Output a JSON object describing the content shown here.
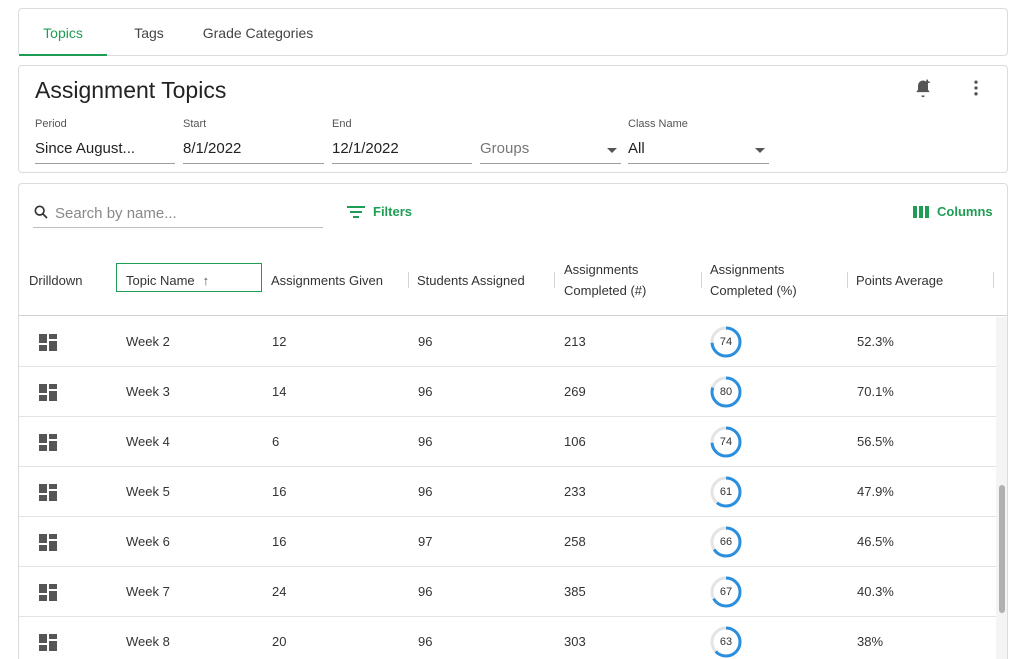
{
  "tabs": [
    {
      "label": "Topics",
      "active": true
    },
    {
      "label": "Tags",
      "active": false
    },
    {
      "label": "Grade Categories",
      "active": false
    }
  ],
  "header": {
    "title": "Assignment Topics",
    "icons": [
      "add-alert-icon",
      "more-vert-icon"
    ],
    "fields": {
      "period": {
        "label": "Period",
        "value": "Since August..."
      },
      "start": {
        "label": "Start",
        "value": "8/1/2022"
      },
      "end": {
        "label": "End",
        "value": "12/1/2022"
      },
      "groups": {
        "label": "",
        "value": "Groups"
      },
      "class_name": {
        "label": "Class Name",
        "value": "All"
      }
    }
  },
  "toolbar": {
    "search_placeholder": "Search by name...",
    "filters_label": "Filters",
    "columns_label": "Columns"
  },
  "table": {
    "columns": [
      {
        "label": "Drilldown"
      },
      {
        "label": "Topic Name",
        "sorted": "ascending"
      },
      {
        "label": "Assignments Given"
      },
      {
        "label": "Students Assigned"
      },
      {
        "label": "Assignments Completed (#)"
      },
      {
        "label": "Assignments Completed (%)"
      },
      {
        "label": "Points Average"
      }
    ],
    "rows": [
      {
        "topic": "Week 2",
        "given": "12",
        "students": "96",
        "completed": "213",
        "pct": "74",
        "points": "52.3%"
      },
      {
        "topic": "Week 3",
        "given": "14",
        "students": "96",
        "completed": "269",
        "pct": "80",
        "points": "70.1%"
      },
      {
        "topic": "Week 4",
        "given": "6",
        "students": "96",
        "completed": "106",
        "pct": "74",
        "points": "56.5%"
      },
      {
        "topic": "Week 5",
        "given": "16",
        "students": "96",
        "completed": "233",
        "pct": "61",
        "points": "47.9%"
      },
      {
        "topic": "Week 6",
        "given": "16",
        "students": "97",
        "completed": "258",
        "pct": "66",
        "points": "46.5%"
      },
      {
        "topic": "Week 7",
        "given": "24",
        "students": "96",
        "completed": "385",
        "pct": "67",
        "points": "40.3%"
      },
      {
        "topic": "Week 8",
        "given": "20",
        "students": "96",
        "completed": "303",
        "pct": "63",
        "points": "38%"
      }
    ]
  },
  "colors": {
    "accent": "#1f9d55",
    "ring": "#2b8fe0",
    "ring_track": "#e4e4e4"
  }
}
